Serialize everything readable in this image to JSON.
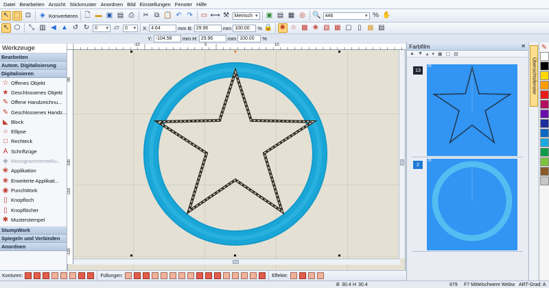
{
  "menu": [
    "Datei",
    "Bearbeiten",
    "Ansicht",
    "Stickmuster",
    "Anordnen",
    "Bild",
    "Einstellungen",
    "Fenster",
    "Hilfe"
  ],
  "toolbar1": {
    "convert_label": "Konvertieren",
    "units_value": "Metrisch",
    "zoom_value": "446"
  },
  "toolbar2": {
    "rotate_value": "0",
    "slant_value": "0",
    "x_label": "X:",
    "x_value": "4.64",
    "y_label": "Y:",
    "y_value": "-104.58",
    "b_label": "B:",
    "b_value": "29.96",
    "h_label": "H:",
    "h_value": "29.96",
    "unit_mm": "mm",
    "pct_b_value": "100.00",
    "pct_h_value": "100.00",
    "pct": "%"
  },
  "left_panel": {
    "title": "Werkzeuge",
    "categories": [
      "Bearbeiten",
      "Autom. Digitalisierung",
      "Digitalisieren"
    ],
    "items": [
      {
        "label": "Offenes Objekt",
        "icon": "☆",
        "color": "#c0392b",
        "disabled": false
      },
      {
        "label": "Geschlossenes Objekt",
        "icon": "★",
        "color": "#c0392b",
        "disabled": false
      },
      {
        "label": "Offene Handzeichnu...",
        "icon": "✎",
        "color": "#c0392b",
        "disabled": false
      },
      {
        "label": "Geschlossenes Handz...",
        "icon": "✎",
        "color": "#c0392b",
        "disabled": false
      },
      {
        "label": "Block",
        "icon": "◣",
        "color": "#c0392b",
        "disabled": false
      },
      {
        "label": "Ellipse",
        "icon": "○",
        "color": "#c0392b",
        "disabled": false
      },
      {
        "label": "Rechteck",
        "icon": "□",
        "color": "#c0392b",
        "disabled": false
      },
      {
        "label": "Schriftzüge",
        "icon": "A",
        "color": "#c0392b",
        "disabled": false
      },
      {
        "label": "Monogrammerstellu...",
        "icon": "◈",
        "color": "#9aa3ae",
        "disabled": true
      },
      {
        "label": "Applikation",
        "icon": "❀",
        "color": "#c0392b",
        "disabled": false
      },
      {
        "label": "Erweiterte Applikati...",
        "icon": "❀",
        "color": "#c0392b",
        "disabled": false
      },
      {
        "label": "PunchWork",
        "icon": "◉",
        "color": "#c0392b",
        "disabled": false
      },
      {
        "label": "Knopfloch",
        "icon": "▯",
        "color": "#c0392b",
        "disabled": false
      },
      {
        "label": "Knopflöcher",
        "icon": "▯",
        "color": "#c0392b",
        "disabled": false
      },
      {
        "label": "Musterstempel",
        "icon": "✱",
        "color": "#c0392b",
        "disabled": false
      }
    ],
    "bottom_categories": [
      "StumpWork",
      "Spiegeln und Verbinden",
      "Anordnen"
    ]
  },
  "rulers": {
    "h_ticks": [
      "-10",
      "0",
      "10"
    ],
    "v_ticks": [
      "-90",
      "-100",
      "-110",
      "-120"
    ]
  },
  "film": {
    "title": "Farbfilm",
    "frames": [
      {
        "number": "13",
        "badge": "23"
      },
      {
        "number": "2",
        "badge": "23"
      }
    ]
  },
  "right_tab": "Übersichtsfenster",
  "palette_colors": [
    "#ffffff",
    "#000000",
    "#ffd800",
    "#ff9d00",
    "#e51c1c",
    "#b30f5e",
    "#6a0dad",
    "#1d2d9b",
    "#0b67c2",
    "#1ca9e0",
    "#0f9b4a",
    "#7fc241",
    "#8a5a2b",
    "#c7c7c7"
  ],
  "bottom_bar": {
    "konturen_label": "Konturen:",
    "fuellungen_label": "Füllungen:",
    "effekte_label": "Effekte:"
  },
  "status": {
    "b_label": "B",
    "b_value": "30.4",
    "h_label": "H",
    "h_value": "30.4",
    "stitches": "679",
    "fabric": "F7 Mittelschwere Webw",
    "art": "ART-Grad: A"
  },
  "colors": {
    "embroidery_ring": "#1aa7d8",
    "star_stitch": "#5a4a3a",
    "film_bg": "#3294f3",
    "selection_handle": "#111111"
  }
}
